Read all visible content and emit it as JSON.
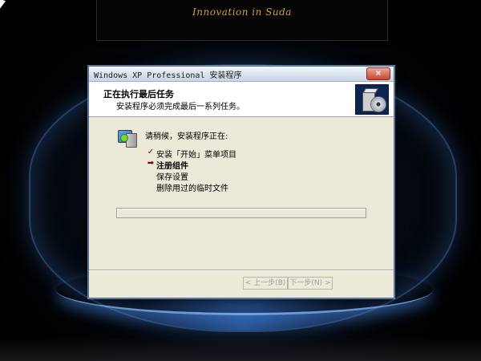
{
  "banner": {
    "text": "Innovation in Suda"
  },
  "window": {
    "title": "Windows XP Professional 安装程序",
    "close_glyph": "×"
  },
  "header": {
    "title": "正在执行最后任务",
    "subtitle": "安装程序必须完成最后一系列任务。",
    "icon": "setup-box-disc-icon"
  },
  "body": {
    "wait_label": "请稍候，安装程序正在:",
    "steps": [
      {
        "label": "安装「开始」菜单项目",
        "status": "done",
        "marker": "✓"
      },
      {
        "label": "注册组件",
        "status": "current",
        "marker": "➡"
      },
      {
        "label": "保存设置",
        "status": "pending",
        "marker": ""
      },
      {
        "label": "删除用过的临时文件",
        "status": "pending",
        "marker": ""
      }
    ],
    "progress": 0
  },
  "buttons": {
    "back": "< 上一步(B)",
    "next": "下一步(N) >"
  },
  "colors": {
    "accent": "#2f6fcf",
    "banner_text": "#c8a24a",
    "window_bg": "#ece9d8",
    "header_icon_bg": "#0d2350"
  }
}
